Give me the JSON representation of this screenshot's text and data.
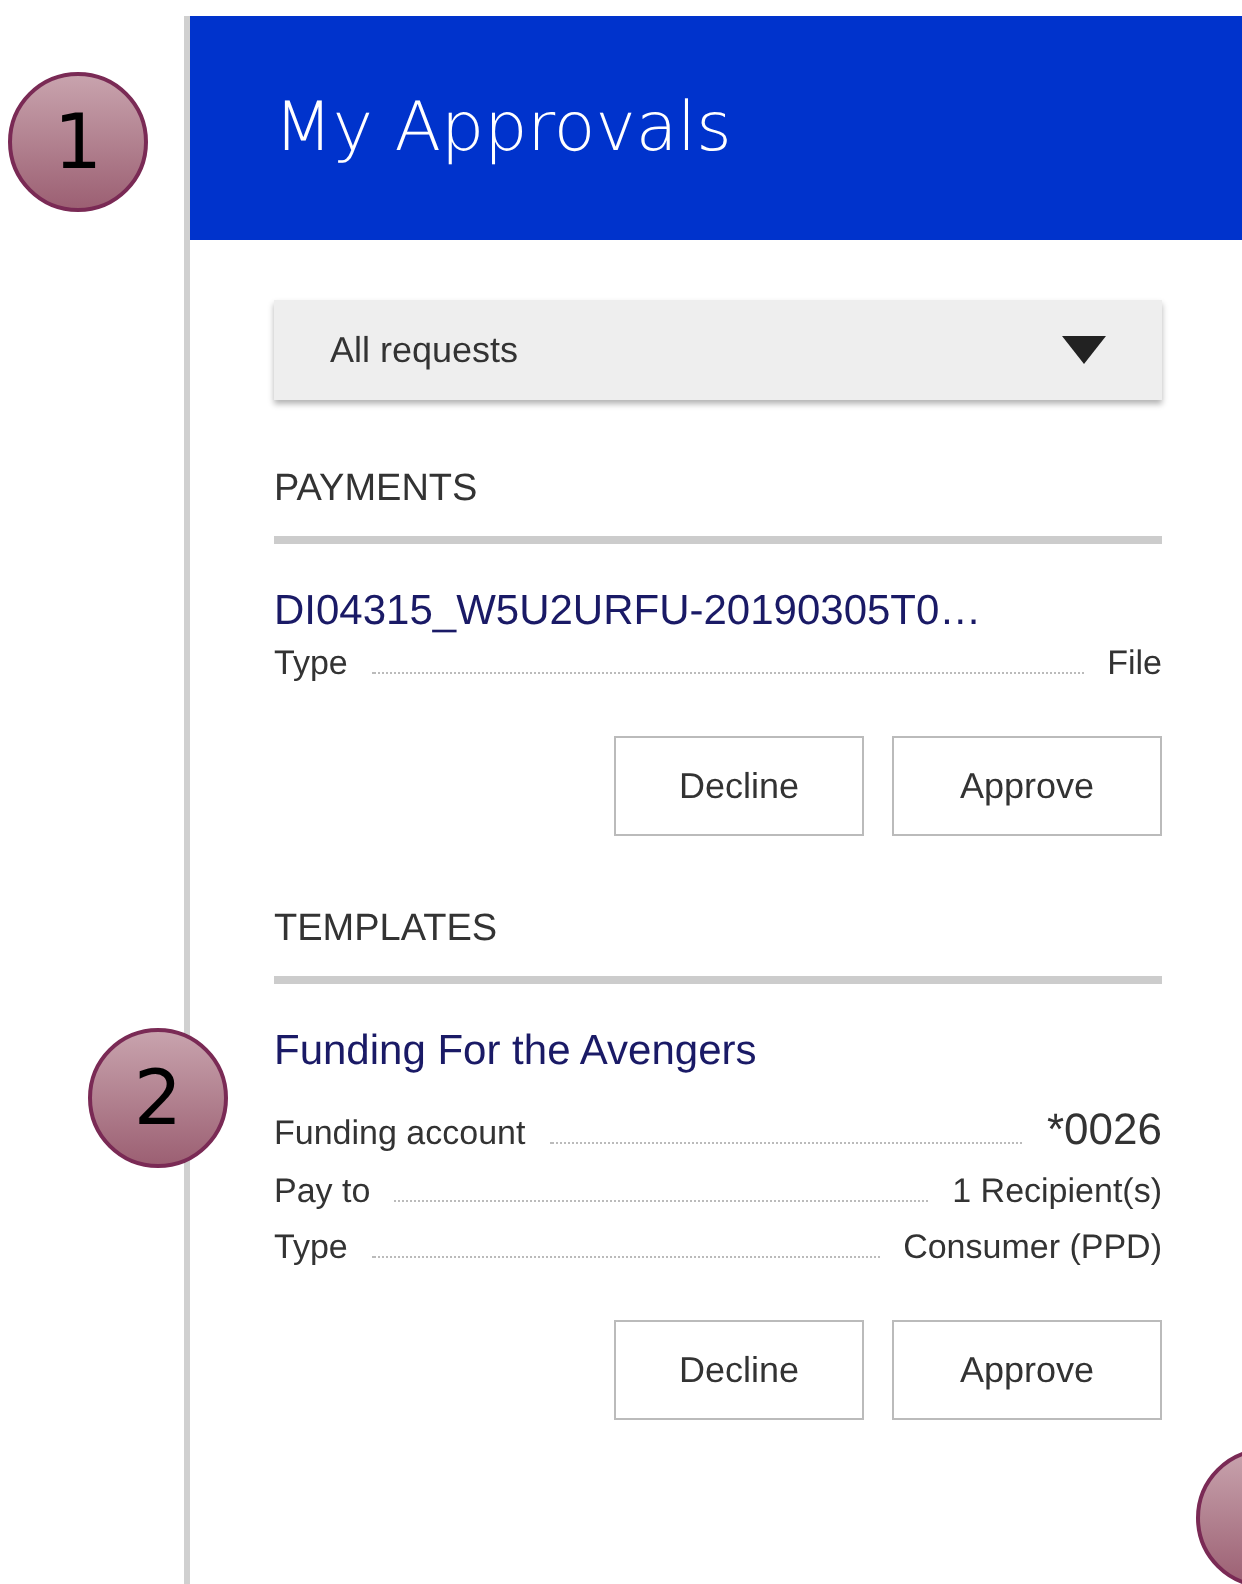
{
  "header": {
    "title": "My Approvals"
  },
  "filter": {
    "value": "All requests"
  },
  "sections": [
    {
      "heading": "PAYMENTS",
      "items": [
        {
          "title": "DI04315_W5U2URFU-20190305T0…",
          "details": [
            {
              "label": "Type",
              "value": "File",
              "emphasized": false
            }
          ],
          "buttons": [
            "Decline",
            "Approve"
          ]
        }
      ]
    },
    {
      "heading": "TEMPLATES",
      "items": [
        {
          "title": "Funding For the Avengers",
          "details": [
            {
              "label": "Funding account",
              "value": "*0026",
              "emphasized": true
            },
            {
              "label": "Pay to",
              "value": "1 Recipient(s)",
              "emphasized": false
            },
            {
              "label": "Type",
              "value": "Consumer (PPD)",
              "emphasized": false
            }
          ],
          "buttons": [
            "Decline",
            "Approve"
          ]
        }
      ]
    }
  ],
  "callouts": [
    {
      "kind": "numbered",
      "label": "1"
    },
    {
      "kind": "numbered",
      "label": "2"
    },
    {
      "kind": "blank"
    }
  ]
}
